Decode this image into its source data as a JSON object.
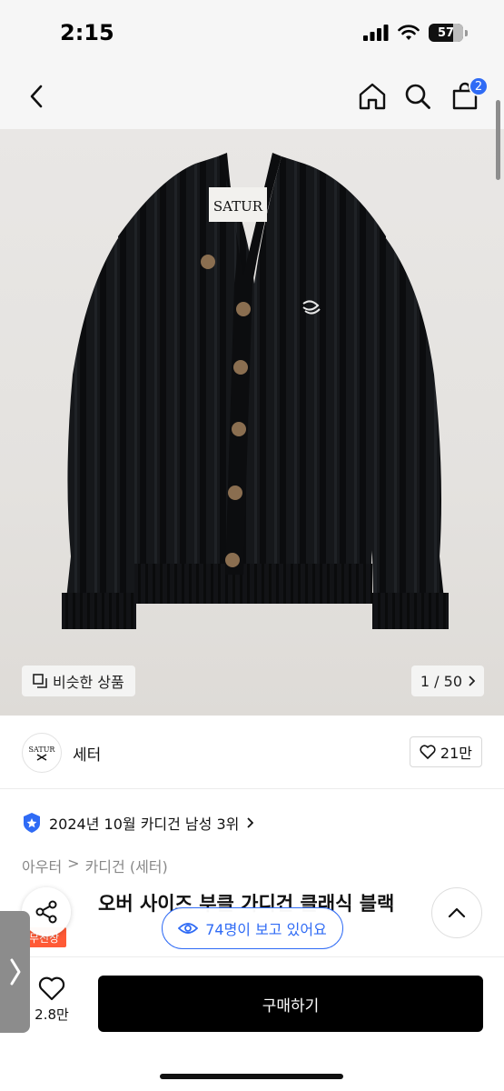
{
  "status_bar": {
    "time": "2:15",
    "battery": "57"
  },
  "nav": {
    "back_icon": "chevron-left-icon",
    "home_icon": "home-icon",
    "search_icon": "search-icon",
    "cart_icon": "shopping-bag-icon",
    "cart_count": "2"
  },
  "image": {
    "similar_label": "비슷한 상품",
    "counter": "1 / 50",
    "label_text": "SATUR"
  },
  "store": {
    "logo_text": "SATUR",
    "name": "세터",
    "likes": "21만"
  },
  "ranking": {
    "text": "2024년 10월 카디건 남성 3위"
  },
  "breadcrumb": {
    "level1": "아우터",
    "separator": ">",
    "level2": "카디건 (세터)"
  },
  "product": {
    "title": "오버 사이즈 부클 가디건 클래식 블랙",
    "tag": "무진장"
  },
  "viewers": {
    "text": "74명이 보고 있어요"
  },
  "bottom": {
    "wish_count": "2.8만",
    "buy_label": "구매하기"
  },
  "colors": {
    "accent": "#2f6bf5",
    "tag": "#ff5a36",
    "buy_button": "#000000"
  }
}
